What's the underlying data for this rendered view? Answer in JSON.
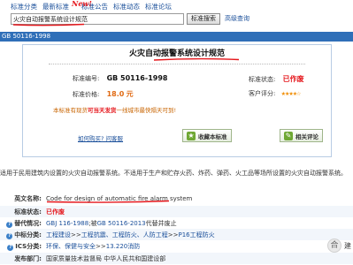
{
  "nav": {
    "items": [
      "标准分类",
      "最新标准",
      "标准公告",
      "标准动态",
      "标准论坛"
    ],
    "new_badge": "New!"
  },
  "search": {
    "value": "火灾自动报警系统设计规范",
    "button": "标准搜索",
    "advanced": "高级查询"
  },
  "titlebar": "GB 50116-1998",
  "standard": {
    "title": "火灾自动报警系统设计规范",
    "number_label": "标准编号:",
    "number": "GB 50116-1998",
    "status_label": "标准状态:",
    "status": "已作废",
    "price_label": "标准价格:",
    "price": "18.0",
    "price_unit": "元",
    "rating_label": "客户评分:",
    "stars": "★★★★☆"
  },
  "promo": {
    "prefix": "本标准有现货",
    "highlight": "可当天发货",
    "suffix": "一线城市最快隔天可到!"
  },
  "actions": {
    "howto": "如何购买? 问客服",
    "favorite": "收藏本标准",
    "comment": "相关评论"
  },
  "description": "适用于民用建筑内设置的火灾自动报警系统。不适用于生产和贮存火药、炸药、弹药、火工品等场所设置的火灾自动报警系统。",
  "info": {
    "english_label": "英文名称:",
    "english": "Code for design of automatic fire alarm system",
    "status_label": "标准状态:",
    "status": "已作废",
    "replace_label": "替代情况:",
    "replace_a": "GBJ 116-1988",
    "replace_mid": ";被",
    "replace_b": "GB 50116-2013",
    "replace_end": "代替并废止",
    "china_class_label": "中标分类:",
    "china_class_parts": [
      "工程建设",
      ">>",
      "工程抗震、工程防火、人防工程",
      ">>",
      "P16工程防火"
    ],
    "ics_label": "ICS分类:",
    "ics_parts": [
      "环保、保健与安全",
      ">>",
      "13.220消防"
    ],
    "publisher_label": "发布部门:",
    "publisher": "国家质量技术监督局  中华人民共和国建设部"
  },
  "watermark": {
    "icon": "合",
    "text": "建"
  }
}
